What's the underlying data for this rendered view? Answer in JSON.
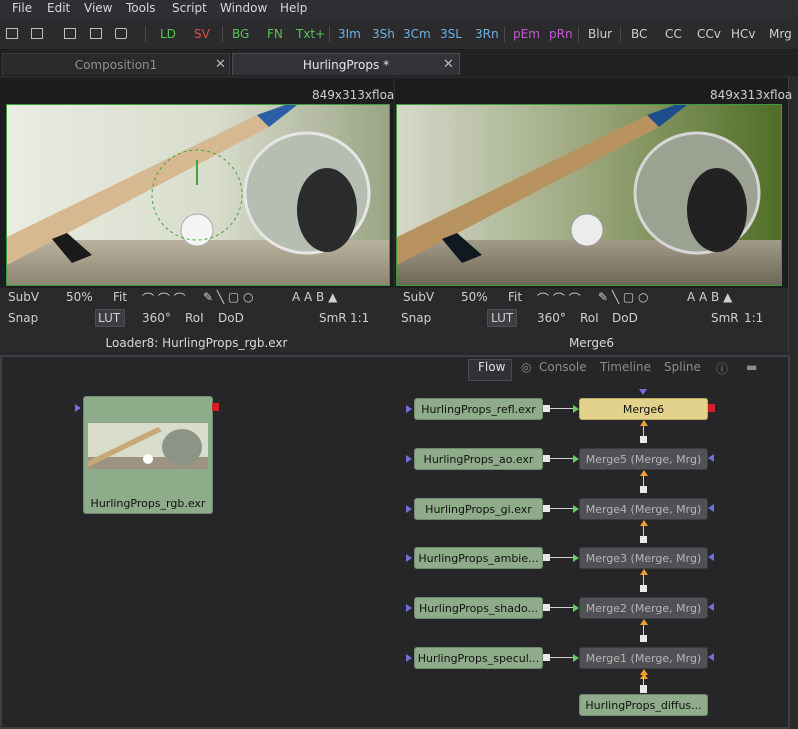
{
  "menu": [
    "File",
    "Edit",
    "View",
    "Tools",
    "Script",
    "Window",
    "Help"
  ],
  "toolbar": {
    "buttons": [
      {
        "label": "LD",
        "color": "#56c356"
      },
      {
        "label": "SV",
        "color": "#d8534a"
      },
      {
        "label": "BG",
        "color": "#56c356"
      },
      {
        "label": "FN",
        "color": "#56c356"
      },
      {
        "label": "Txt+",
        "color": "#56c356"
      },
      {
        "label": "3Im",
        "color": "#6fb1e0"
      },
      {
        "label": "3Sh",
        "color": "#6fb1e0"
      },
      {
        "label": "3Cm",
        "color": "#6fb1e0"
      },
      {
        "label": "3SL",
        "color": "#6fb1e0"
      },
      {
        "label": "3Rn",
        "color": "#6fb1e0"
      },
      {
        "label": "pEm",
        "color": "#c45ad1"
      },
      {
        "label": "pRn",
        "color": "#c45ad1"
      },
      {
        "label": "Blur",
        "color": "#cfcfcf"
      },
      {
        "label": "BC",
        "color": "#cfcfcf"
      },
      {
        "label": "CC",
        "color": "#cfcfcf"
      },
      {
        "label": "CCv",
        "color": "#cfcfcf"
      },
      {
        "label": "HCv",
        "color": "#cfcfcf"
      },
      {
        "label": "Mrg",
        "color": "#cfcfcf"
      }
    ]
  },
  "tabs": [
    {
      "label": "Composition1",
      "active": false
    },
    {
      "label": "HurlingProps *",
      "active": true
    }
  ],
  "viewers": [
    {
      "resolution": "849x313xfloa",
      "row1": {
        "subv": "SubV",
        "zoom": "50%",
        "fit": "Fit"
      },
      "row2": {
        "snap": "Snap",
        "lut": "LUT",
        "angle": "360°",
        "roi": "RoI",
        "dod": "DoD",
        "smr": "SmR",
        "ratio": "1:1"
      },
      "label": "Loader8: HurlingProps_rgb.exr"
    },
    {
      "resolution": "849x313xfloa",
      "row1": {
        "subv": "SubV",
        "zoom": "50%",
        "fit": "Fit"
      },
      "row2": {
        "snap": "Snap",
        "lut": "LUT",
        "angle": "360°",
        "roi": "RoI",
        "dod": "DoD",
        "smr": "SmR",
        "ratio": "1:1"
      },
      "label": "Merge6"
    }
  ],
  "flow_tabs": [
    "Flow",
    "Console",
    "Timeline",
    "Spline"
  ],
  "nodes": {
    "loader_main": "HurlingProps_rgb.exr",
    "loaders": [
      "HurlingProps_refl.exr",
      "HurlingProps_ao.exr",
      "HurlingProps_gi.exr",
      "HurlingProps_ambie...",
      "HurlingProps_shado...",
      "HurlingProps_specul..."
    ],
    "merges": [
      "Merge6",
      "Merge5  (Merge, Mrg)",
      "Merge4  (Merge, Mrg)",
      "Merge3  (Merge, Mrg)",
      "Merge2  (Merge, Mrg)",
      "Merge1  (Merge, Mrg)"
    ],
    "diffuse": "HurlingProps_diffus..."
  },
  "colors": {
    "accent_green": "#56c356",
    "node_loader": "#8fac8a",
    "node_merge": "#505055",
    "node_selected": "#e2d28b"
  }
}
